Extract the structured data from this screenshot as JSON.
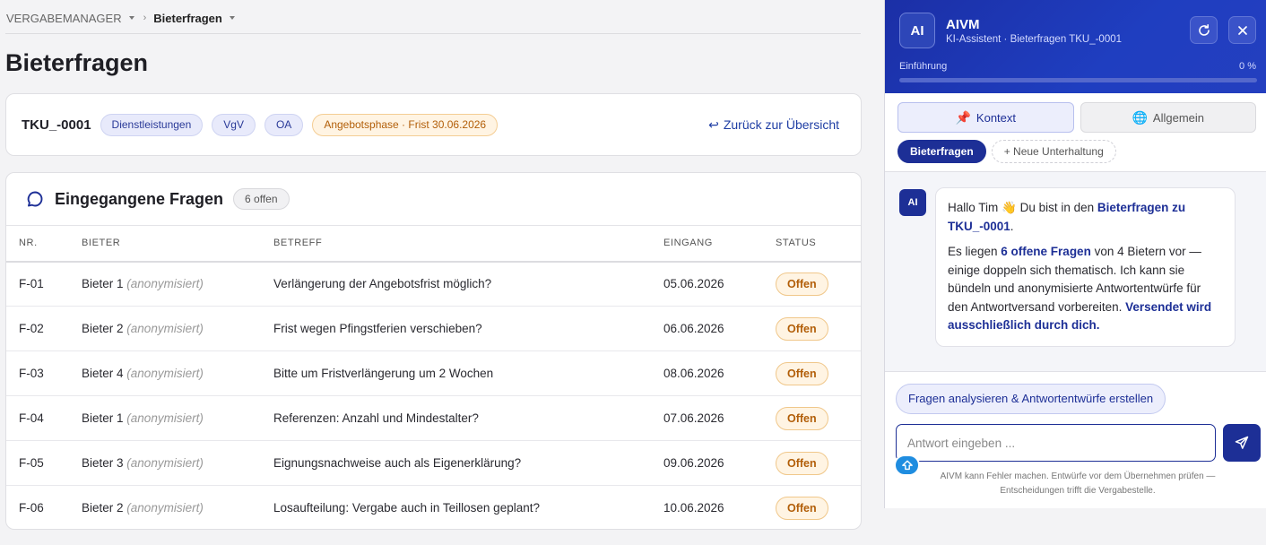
{
  "breadcrumb": {
    "root": "VERGABEMANAGER",
    "current": "Bieterfragen"
  },
  "page": {
    "title": "Bieterfragen"
  },
  "tender": {
    "id": "TKU_-0001",
    "tags": [
      "Dienstleistungen",
      "VgV",
      "OA"
    ],
    "phase": "Angebotsphase · Frist 30.06.2026",
    "back_label": "Zurück zur Übersicht"
  },
  "questions": {
    "title": "Eingegangene Fragen",
    "badge": "6 offen",
    "columns": {
      "nr": "NR.",
      "bidder": "BIETER",
      "subject": "BETREFF",
      "date": "EINGANG",
      "status": "STATUS"
    },
    "rows": [
      {
        "nr": "F-01",
        "bidder": "Bieter 1",
        "anon": "(anonymisiert)",
        "subject": "Verlängerung der Angebotsfrist möglich?",
        "date": "05.06.2026",
        "status": "Offen"
      },
      {
        "nr": "F-02",
        "bidder": "Bieter 2",
        "anon": "(anonymisiert)",
        "subject": "Frist wegen Pfingstferien verschieben?",
        "date": "06.06.2026",
        "status": "Offen"
      },
      {
        "nr": "F-03",
        "bidder": "Bieter 4",
        "anon": "(anonymisiert)",
        "subject": "Bitte um Fristverlängerung um 2 Wochen",
        "date": "08.06.2026",
        "status": "Offen"
      },
      {
        "nr": "F-04",
        "bidder": "Bieter 1",
        "anon": "(anonymisiert)",
        "subject": "Referenzen: Anzahl und Mindestalter?",
        "date": "07.06.2026",
        "status": "Offen"
      },
      {
        "nr": "F-05",
        "bidder": "Bieter 3",
        "anon": "(anonymisiert)",
        "subject": "Eignungsnachweise auch als Eigenerklärung?",
        "date": "09.06.2026",
        "status": "Offen"
      },
      {
        "nr": "F-06",
        "bidder": "Bieter 2",
        "anon": "(anonymisiert)",
        "subject": "Losaufteilung: Vergabe auch in Teillosen geplant?",
        "date": "10.06.2026",
        "status": "Offen"
      }
    ]
  },
  "assistant": {
    "avatar": "AI",
    "name": "AIVM",
    "subtitle": "KI-Assistent · Bieterfragen TKU_-0001",
    "progress_label": "Einführung",
    "progress_text": "0 %",
    "progress_value": 0,
    "tabs": {
      "context": "Kontext",
      "context_icon": "pin-icon",
      "general": "Allgemein",
      "general_icon": "globe-icon"
    },
    "conversations": {
      "active": "Bieterfragen",
      "new": "+ Neue Unterhaltung"
    },
    "message": {
      "avatar": "AI",
      "p1_pre": "Hallo Tim 👋 Du bist in den ",
      "p1_bold": "Bieterfragen zu TKU_-0001",
      "p1_post": ".",
      "p2_pre": "Es liegen ",
      "p2_bold": "6 offene Fragen",
      "p2_mid": " von 4 Bietern vor — einige doppeln sich thematisch. Ich kann sie bündeln und anonymisierte Antwortentwürfe für den Antwortversand vorbereiten. ",
      "p2_bold2": "Versendet wird ausschließlich durch dich."
    },
    "action_chip": "Fragen analysieren & Antwortentwürfe erstellen",
    "input_placeholder": "Antwort eingeben ...",
    "disclaimer": "AIVM kann Fehler machen. Entwürfe vor dem Übernehmen prüfen — Entscheidungen trifft die Vergabestelle."
  },
  "colors": {
    "brand": "#1d2f96",
    "status_open": "#b25e08",
    "header_gradient": "#1f3ec0"
  }
}
